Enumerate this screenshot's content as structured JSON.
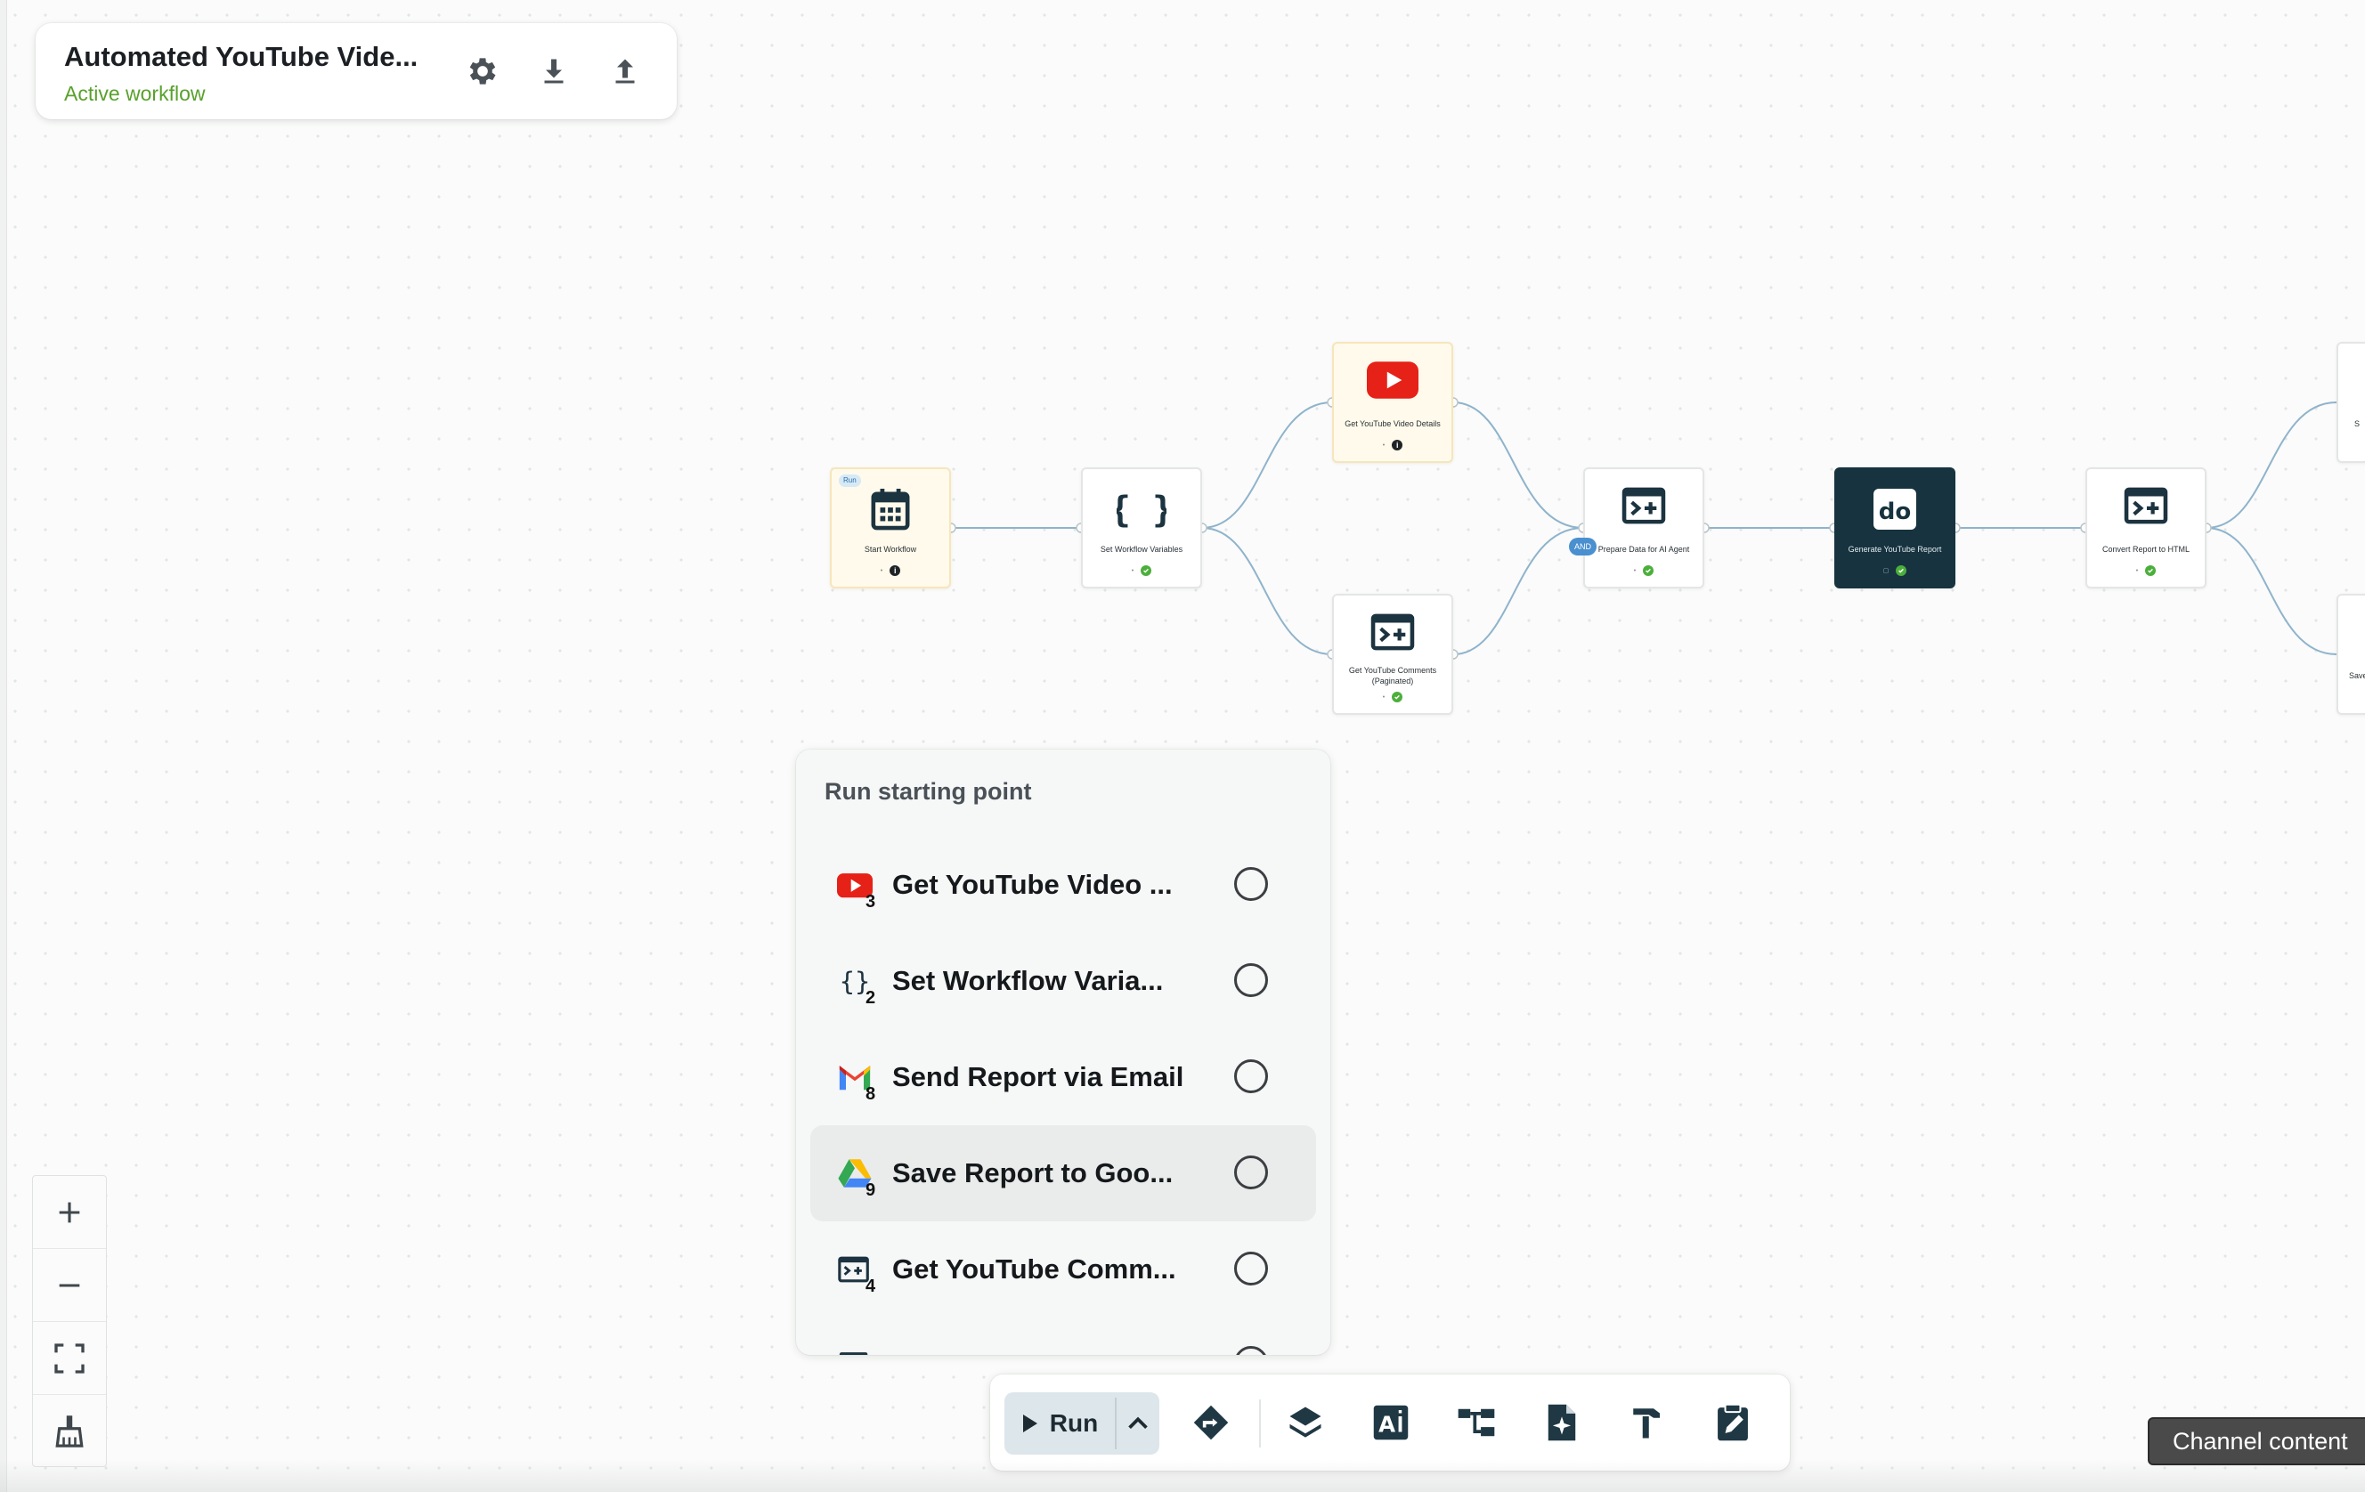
{
  "header": {
    "title": "Automated YouTube Vide...",
    "status": "Active workflow",
    "icons": [
      "gear-icon",
      "download-icon",
      "upload-icon"
    ]
  },
  "nodes": {
    "start": {
      "label": "Start Workflow",
      "tag": "Run"
    },
    "set_vars": {
      "label": "Set Workflow Variables"
    },
    "get_video": {
      "label": "Get YouTube Video Details"
    },
    "get_comments": {
      "label": "Get YouTube Comments (Paginated)"
    },
    "prepare": {
      "label": "Prepare Data for AI Agent",
      "tag": "AND"
    },
    "generate": {
      "label": "Generate YouTube Report"
    },
    "convert": {
      "label": "Convert Report to HTML"
    },
    "partial_top": {
      "label": "S"
    },
    "partial_bottom": {
      "label": "Save"
    }
  },
  "run_panel": {
    "title": "Run starting point",
    "items": [
      {
        "label": "Get YouTube Video ...",
        "number": "3",
        "icon": "youtube-icon"
      },
      {
        "label": "Set Workflow Varia...",
        "number": "2",
        "icon": "braces-icon"
      },
      {
        "label": "Send Report via Email",
        "number": "8",
        "icon": "gmail-icon"
      },
      {
        "label": "Save Report to Goo...",
        "number": "9",
        "icon": "google-drive-icon"
      },
      {
        "label": "Get YouTube Comm...",
        "number": "4",
        "icon": "code-box-icon"
      }
    ]
  },
  "toolbar": {
    "run_label": "Run",
    "buttons": [
      "redirect-icon",
      "layers-icon",
      "ai-text-icon",
      "tree-icon",
      "file-spark-icon",
      "hammer-icon",
      "clipboard-edit-icon"
    ]
  },
  "zoom": {
    "controls": [
      "zoom-in",
      "zoom-out",
      "fit-view",
      "clean-up"
    ]
  },
  "tooltip": {
    "text": "Channel content"
  },
  "colors": {
    "accent_green": "#58a12b",
    "dark_node": "#16333f",
    "youtube_red": "#e62117",
    "edge": "#8fb3cc"
  }
}
